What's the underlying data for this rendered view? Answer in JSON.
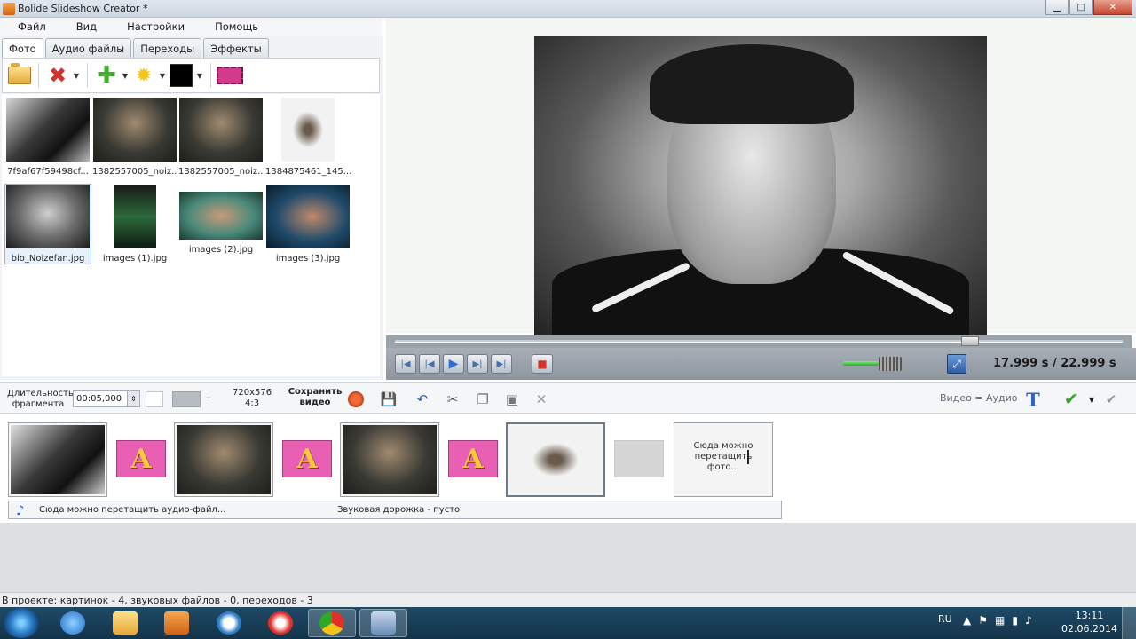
{
  "window": {
    "title": "Bolide Slideshow Creator *"
  },
  "menu": [
    "Файл",
    "Вид",
    "Настройки",
    "Помощь"
  ],
  "tabs": [
    "Фото",
    "Аудио файлы",
    "Переходы",
    "Эффекты"
  ],
  "thumbnails": [
    {
      "name": "7f9af67f59498cf..."
    },
    {
      "name": "1382557005_noiz..."
    },
    {
      "name": "1382557005_noiz..."
    },
    {
      "name": "1384875461_145..."
    },
    {
      "name": "bio_Noizefan.jpg"
    },
    {
      "name": "images (1).jpg"
    },
    {
      "name": "images (2).jpg"
    },
    {
      "name": "images (3).jpg"
    }
  ],
  "player": {
    "time_current": "17.999 s",
    "time_total": "/ 22.999 s",
    "progress": 0.79
  },
  "timeline_toolbar": {
    "duration_label": "Длительность фрагмента",
    "duration_value": "00:05,000",
    "resolution": "720x576",
    "aspect": "4:3",
    "save_video": "Сохранить видео",
    "video_audio": "Видео = Аудио"
  },
  "storyboard": {
    "drop_photo": "Сюда можно перетащить фото...",
    "audio_drop": "Сюда можно перетащить аудио-файл...",
    "audio_empty": "Звуковая дорожка - пусто"
  },
  "status": "В проекте: картинок - 4, звуковых файлов - 0, переходов - 3",
  "taskbar": {
    "lang": "RU",
    "time": "13:11",
    "date": "02.06.2014"
  },
  "colors": {
    "accent": "#2f62c8",
    "transition": "#e85fb4",
    "record": "#d0342c"
  }
}
